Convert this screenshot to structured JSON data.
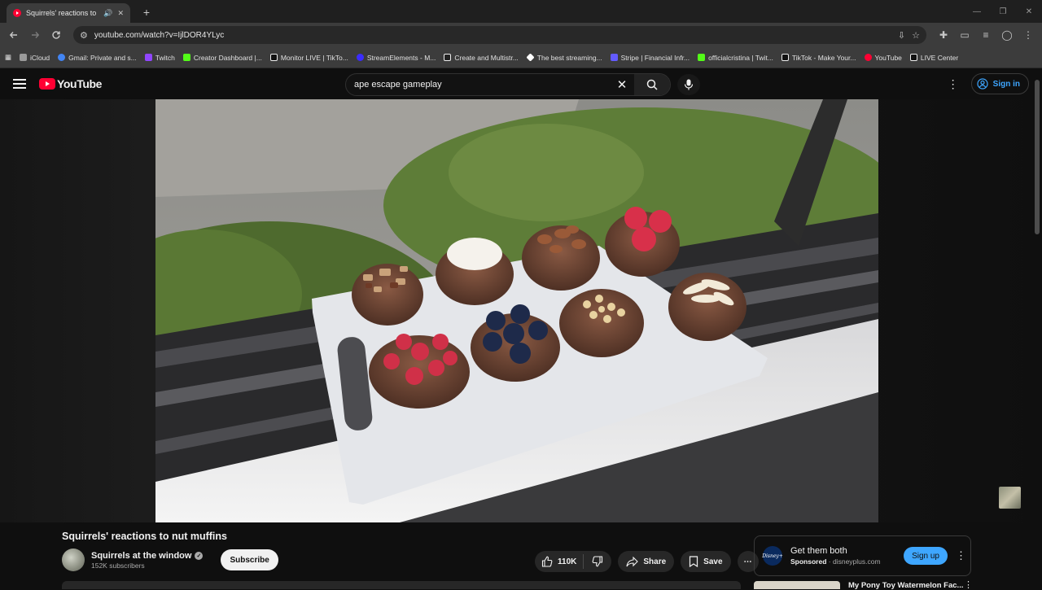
{
  "browser": {
    "tab_title": "Squirrels' reactions to nut muffins",
    "tab_audio_icon": "speaker-icon",
    "new_tab_label": "+",
    "url": "youtube.com/watch?v=IjlDOR4YLyc",
    "window_controls": [
      "—",
      "❐",
      "✕"
    ],
    "bookmarks": [
      {
        "label": "iCloud",
        "color": "#9a9a9a"
      },
      {
        "label": "Gmail: Private and s...",
        "color": "#4285f4"
      },
      {
        "label": "Twitch",
        "color": "#9146ff"
      },
      {
        "label": "Creator Dashboard |...",
        "color": "#53fc18"
      },
      {
        "label": "Monitor LIVE | TikTo...",
        "color": "#ffffff"
      },
      {
        "label": "StreamElements - M...",
        "color": "#3b2cff"
      },
      {
        "label": "Create and Multistr...",
        "color": "#222222"
      },
      {
        "label": "The best streaming...",
        "color": "#ffffff"
      },
      {
        "label": "Stripe | Financial Infr...",
        "color": "#635bff"
      },
      {
        "label": "officialcristina | Twit...",
        "color": "#53fc18"
      },
      {
        "label": "TikTok - Make Your...",
        "color": "#ffffff"
      },
      {
        "label": "YouTube",
        "color": "#ff0033"
      },
      {
        "label": "LIVE Center",
        "color": "#ffffff"
      }
    ]
  },
  "masthead": {
    "logo_text": "YouTube",
    "search_value": "ape escape gameplay",
    "clear_label": "✕",
    "more_label": "⋮",
    "signin_label": "Sign in"
  },
  "video": {
    "title": "Squirrels' reactions to nut muffins",
    "channel_name": "Squirrels at the window",
    "subscribers": "152K subscribers",
    "subscribe_label": "Subscribe",
    "likes": "110K",
    "share_label": "Share",
    "save_label": "Save",
    "more_label": "⋯",
    "verified_mark": "✓"
  },
  "ad": {
    "title": "Get them both",
    "sponsored": "Sponsored",
    "domain": "· disneyplus.com",
    "cta": "Sign up",
    "logo_text": "Disney+",
    "kebab": "⋮"
  },
  "up_next": {
    "title_partial": "My Pony Toy Watermelon Fac...",
    "kebab": "⋮"
  },
  "colors": {
    "accent": "#3ea6ff",
    "brand": "#ff0033",
    "background": "#0f0f0f"
  }
}
